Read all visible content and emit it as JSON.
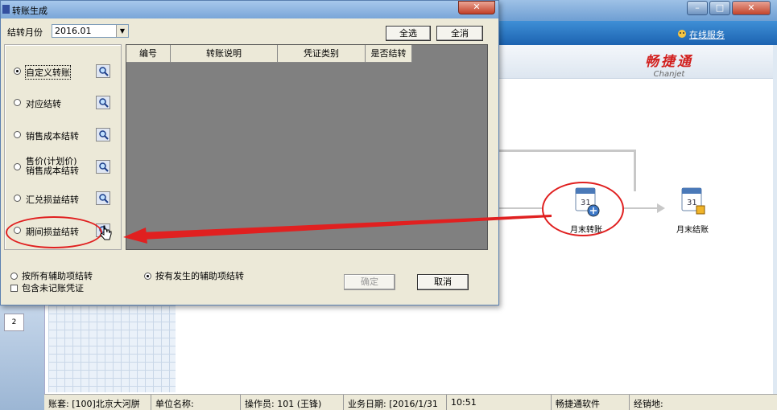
{
  "background": {
    "online_service": "在线服务",
    "brand_cn": "畅捷通",
    "brand_en": "Chanjet",
    "rail_tile": "2",
    "flow": [
      {
        "label": "月末转账"
      },
      {
        "label": "月末结账"
      }
    ],
    "status_bar": [
      "账套: [100]北京大河胼",
      "单位名称:",
      "操作员: 101 (王锋)",
      "业务日期: [2016/1/31",
      "10:51",
      "畅捷通软件",
      "经销地:"
    ],
    "window_controls": [
      "–",
      "□",
      "✕"
    ]
  },
  "dialog": {
    "title": "转账生成",
    "close": "✕",
    "month_label": "结转月份",
    "month_value": "2016.01",
    "select_all": "全选",
    "deselect_all": "全消",
    "options": [
      {
        "label": "自定义转账",
        "selected": true
      },
      {
        "label": "对应结转",
        "selected": false
      },
      {
        "label": "销售成本结转",
        "selected": false
      },
      {
        "label_line1": "售价(计划价)",
        "label_line2": "销售成本结转",
        "selected": false
      },
      {
        "label": "汇兑损益结转",
        "selected": false
      },
      {
        "label": "期间损益结转",
        "selected": false
      }
    ],
    "columns": [
      "编号",
      "转账说明",
      "凭证类别",
      "是否结转"
    ],
    "radio_all_aux": "按所有辅助项结转",
    "radio_occurred_aux": "按有发生的辅助项结转",
    "checkbox_unposted": "包含未记账凭证",
    "confirm": "确定",
    "cancel": "取消"
  },
  "icons": {
    "search": "magnifier-icon",
    "calendar": "calendar-icon"
  },
  "colors": {
    "annotation": "#e02020",
    "toolbar": "#1c63b1",
    "grid_bg": "#808080"
  }
}
